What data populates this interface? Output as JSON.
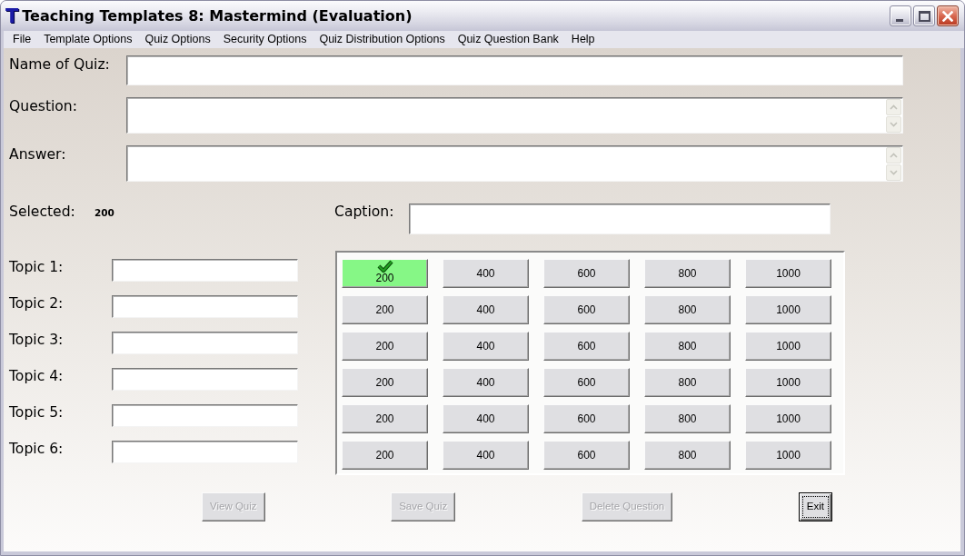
{
  "window": {
    "icon": "T",
    "title": "Teaching Templates 8: Mastermind (Evaluation)"
  },
  "menu": [
    "File",
    "Template Options",
    "Quiz Options",
    "Security Options",
    "Quiz Distribution Options",
    "Quiz Question Bank",
    "Help"
  ],
  "fields": [
    {
      "label": "Name of Quiz:",
      "kind": "line"
    },
    {
      "label": "Question:",
      "kind": "multiline"
    },
    {
      "label": "Answer:",
      "kind": "multiline"
    }
  ],
  "selected": {
    "label": "Selected:",
    "value": "200"
  },
  "caption": {
    "label": "Caption:"
  },
  "topics": [
    {
      "label": "Topic 1:"
    },
    {
      "label": "Topic 2:"
    },
    {
      "label": "Topic 3:"
    },
    {
      "label": "Topic 4:"
    },
    {
      "label": "Topic 5:"
    },
    {
      "label": "Topic 6:"
    }
  ],
  "board": {
    "rows": [
      [
        {
          "value": "200",
          "selected": true
        },
        {
          "value": "400",
          "selected": false
        },
        {
          "value": "600",
          "selected": false
        },
        {
          "value": "800",
          "selected": false
        },
        {
          "value": "1000",
          "selected": false
        }
      ],
      [
        {
          "value": "200",
          "selected": false
        },
        {
          "value": "400",
          "selected": false
        },
        {
          "value": "600",
          "selected": false
        },
        {
          "value": "800",
          "selected": false
        },
        {
          "value": "1000",
          "selected": false
        }
      ],
      [
        {
          "value": "200",
          "selected": false
        },
        {
          "value": "400",
          "selected": false
        },
        {
          "value": "600",
          "selected": false
        },
        {
          "value": "800",
          "selected": false
        },
        {
          "value": "1000",
          "selected": false
        }
      ],
      [
        {
          "value": "200",
          "selected": false
        },
        {
          "value": "400",
          "selected": false
        },
        {
          "value": "600",
          "selected": false
        },
        {
          "value": "800",
          "selected": false
        },
        {
          "value": "1000",
          "selected": false
        }
      ],
      [
        {
          "value": "200",
          "selected": false
        },
        {
          "value": "400",
          "selected": false
        },
        {
          "value": "600",
          "selected": false
        },
        {
          "value": "800",
          "selected": false
        },
        {
          "value": "1000",
          "selected": false
        }
      ],
      [
        {
          "value": "200",
          "selected": false
        },
        {
          "value": "400",
          "selected": false
        },
        {
          "value": "600",
          "selected": false
        },
        {
          "value": "800",
          "selected": false
        },
        {
          "value": "1000",
          "selected": false
        }
      ]
    ]
  },
  "buttons": [
    {
      "label": "View Quiz",
      "disabled": true,
      "focused": false
    },
    {
      "label": "Save Quiz",
      "disabled": true,
      "focused": false
    },
    {
      "label": "Delete Question",
      "disabled": true,
      "focused": false
    },
    {
      "label": "Exit",
      "disabled": false,
      "focused": true
    }
  ]
}
